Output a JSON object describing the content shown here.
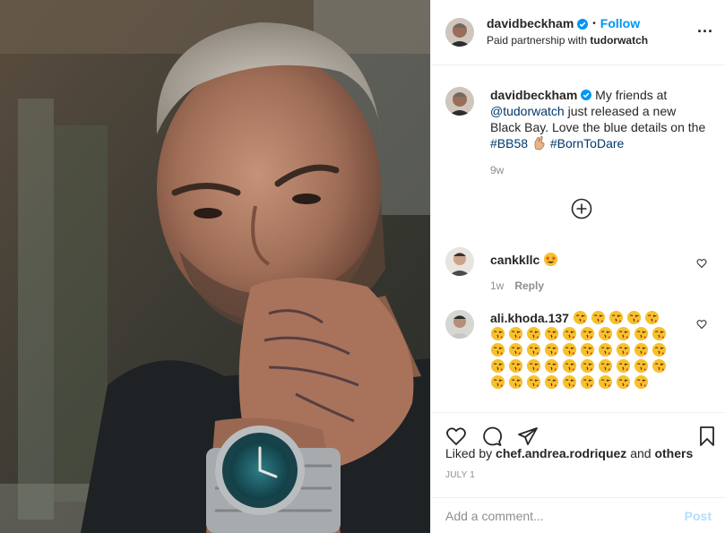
{
  "post": {
    "author": {
      "username": "davidbeckham",
      "verified": true,
      "follow_label": "Follow",
      "separator": "•",
      "paid_prefix": "Paid partnership with ",
      "paid_partner": "tudorwatch",
      "more_label": "..."
    },
    "caption": {
      "username": "davidbeckham",
      "text_before": "My friends at ",
      "mention": "@tudorwatch",
      "text_after": " just released a new Black Bay. Love the blue details on the ",
      "hashtag1": "#BB58",
      "hashtag2": "#BornToDare",
      "time": "9w"
    },
    "comments": [
      {
        "username": "cankkllc",
        "time": "1w",
        "reply_label": "Reply",
        "emoji": "star-struck"
      },
      {
        "username": "ali.khoda.137",
        "emoji": "face-blowing-kiss",
        "emoji_count": 44
      }
    ],
    "likes": {
      "prefix": "Liked by ",
      "user": "chef.andrea.rodriquez",
      "middle": " and ",
      "others": "others"
    },
    "date": "JULY 1",
    "add_comment": {
      "placeholder": "Add a comment...",
      "post_label": "Post"
    },
    "colors": {
      "accent": "#0095f6",
      "link": "#00376b",
      "muted": "#8e8e8e",
      "border": "#efefef",
      "watch_dial": "#1f5f6b"
    }
  }
}
